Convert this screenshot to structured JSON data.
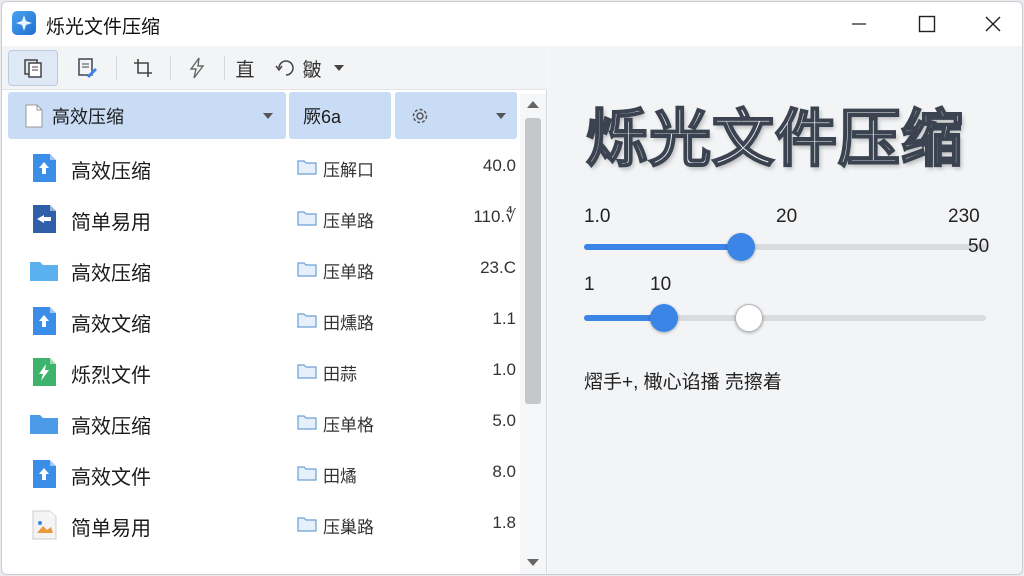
{
  "window": {
    "title": "烁光文件压缩",
    "icon": "app-logo-icon"
  },
  "toolbar": {
    "buttons": [
      {
        "name": "copy-icon"
      },
      {
        "name": "edit-document-icon"
      },
      {
        "name": "crop-icon"
      },
      {
        "name": "lightning-icon"
      }
    ],
    "text_button_1": "直",
    "text_button_2": "皺"
  },
  "columns": {
    "name_header": "高效压缩",
    "loc_header": "厥6a",
    "settings_icon": "gear-icon"
  },
  "files": [
    {
      "name": "高效压缩",
      "location": "压解口",
      "size": "40.0",
      "icon": "upload-file-icon",
      "color": "#3b8ee8"
    },
    {
      "name": "简单易用",
      "location": "压单路",
      "size": "110.∜",
      "icon": "share-file-icon",
      "color": "#2f5fa8"
    },
    {
      "name": "高效压缩",
      "location": "压单路",
      "size": "23.C",
      "icon": "folder-icon",
      "color": "#5bb1ee"
    },
    {
      "name": "高效文缩",
      "location": "田燻路",
      "size": "1.1",
      "icon": "upload-file-icon",
      "color": "#3b8ee8"
    },
    {
      "name": "烁烈文件",
      "location": "田蒜",
      "size": "1.0",
      "icon": "lightning-file-icon",
      "color": "#3db36b"
    },
    {
      "name": "高效压缩",
      "location": "压单格",
      "size": "5.0",
      "icon": "folder-icon",
      "color": "#4c9be8"
    },
    {
      "name": "高效文件",
      "location": "田燏",
      "size": "8.0",
      "icon": "upload-file-icon",
      "color": "#3b8ee8"
    },
    {
      "name": "简单易用",
      "location": "压巢路",
      "size": "1.8",
      "icon": "image-file-icon",
      "color": "#e8b84c"
    }
  ],
  "right": {
    "big_title": "烁光文件压缩",
    "slider1": {
      "ticks": [
        "1.0",
        "20",
        "230"
      ],
      "end_label": "50",
      "value_fraction": 0.39
    },
    "slider2": {
      "ticks": [
        "1",
        "10"
      ],
      "value_fraction": 0.2,
      "second_fraction": 0.41
    },
    "status": "熠手+, 橄心谄播  売擦着"
  },
  "colors": {
    "accent": "#3a85e6",
    "header": "#c8dcf5"
  }
}
